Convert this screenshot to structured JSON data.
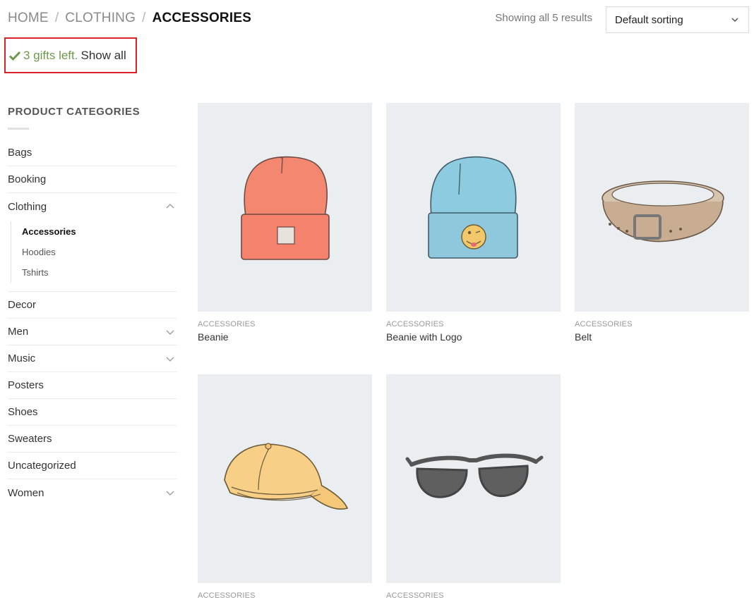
{
  "breadcrumb": {
    "items": [
      "HOME",
      "CLOTHING"
    ],
    "separator": "/",
    "current": "ACCESSORIES"
  },
  "results": {
    "count_text": "Showing all 5 results"
  },
  "sorting": {
    "selected": "Default sorting"
  },
  "gifts": {
    "text": "3 gifts left.",
    "link": "Show all"
  },
  "sidebar": {
    "title": "PRODUCT CATEGORIES",
    "items": [
      {
        "label": "Bags"
      },
      {
        "label": "Booking"
      },
      {
        "label": "Clothing",
        "sub": [
          "Accessories",
          "Hoodies",
          "Tshirts"
        ],
        "active_sub": "Accessories"
      },
      {
        "label": "Decor"
      },
      {
        "label": "Men"
      },
      {
        "label": "Music"
      },
      {
        "label": "Posters"
      },
      {
        "label": "Shoes"
      },
      {
        "label": "Sweaters"
      },
      {
        "label": "Uncategorized"
      },
      {
        "label": "Women"
      }
    ]
  },
  "products": [
    {
      "category": "ACCESSORIES",
      "name": "Beanie",
      "icon": "beanie-orange-icon"
    },
    {
      "category": "ACCESSORIES",
      "name": "Beanie with Logo",
      "icon": "beanie-blue-logo-icon"
    },
    {
      "category": "ACCESSORIES",
      "name": "Belt",
      "icon": "belt-icon"
    },
    {
      "category": "ACCESSORIES",
      "name": "",
      "icon": "cap-icon"
    },
    {
      "category": "ACCESSORIES",
      "name": "",
      "icon": "sunglasses-icon"
    }
  ],
  "colors": {
    "gift_green": "#6f9a4e",
    "notice_border": "#d8232a",
    "thumb_bg": "#eaeef1"
  }
}
